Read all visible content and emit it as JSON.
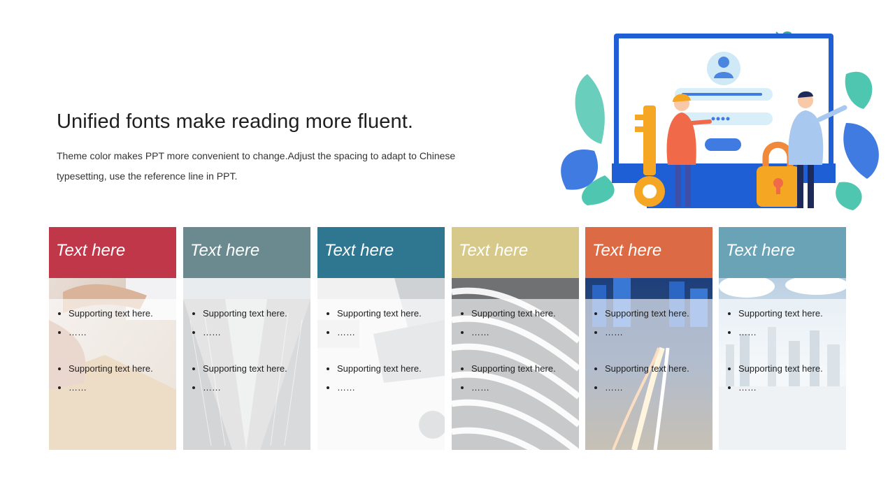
{
  "header": {
    "title": "Unified fonts make reading more fluent.",
    "description": "Theme color makes PPT more convenient to change.Adjust the spacing to adapt to Chinese typesetting, use the reference line in PPT."
  },
  "illustration": {
    "name": "login-security-illustration",
    "colors": {
      "screen": "#1f5fd6",
      "key": "#f5a623",
      "lock": "#f08a3a",
      "leaf_teal": "#4fc7b0",
      "leaf_blue": "#3f7be0"
    }
  },
  "cards": [
    {
      "title": "Text here",
      "color": "#c0374a",
      "photo": "handshake-document-photo",
      "bullets_1": [
        "Supporting text here.",
        "……"
      ],
      "bullets_2": [
        "Supporting text here.",
        "……"
      ]
    },
    {
      "title": "Text here",
      "color": "#6b8a8f",
      "photo": "skyscraper-photo",
      "bullets_1": [
        "Supporting text here.",
        "……"
      ],
      "bullets_2": [
        "Supporting text here.",
        "……"
      ]
    },
    {
      "title": "Text here",
      "color": "#2f7691",
      "photo": "laptop-desk-photo",
      "bullets_1": [
        "Supporting text here.",
        "……"
      ],
      "bullets_2": [
        "Supporting text here.",
        "……"
      ]
    },
    {
      "title": "Text here",
      "color": "#d7c98a",
      "photo": "curved-building-photo",
      "bullets_1": [
        "Supporting text here.",
        "……"
      ],
      "bullets_2": [
        "Supporting text here.",
        "……"
      ]
    },
    {
      "title": "Text here",
      "color": "#dc6b45",
      "photo": "city-night-road-photo",
      "bullets_1": [
        "Supporting text here.",
        "……"
      ],
      "bullets_2": [
        "Supporting text here.",
        "……"
      ]
    },
    {
      "title": "Text here",
      "color": "#6aa2b6",
      "photo": "city-skyline-water-photo",
      "bullets_1": [
        "Supporting text here.",
        "……"
      ],
      "bullets_2": [
        "Supporting text here.",
        "……"
      ]
    }
  ]
}
